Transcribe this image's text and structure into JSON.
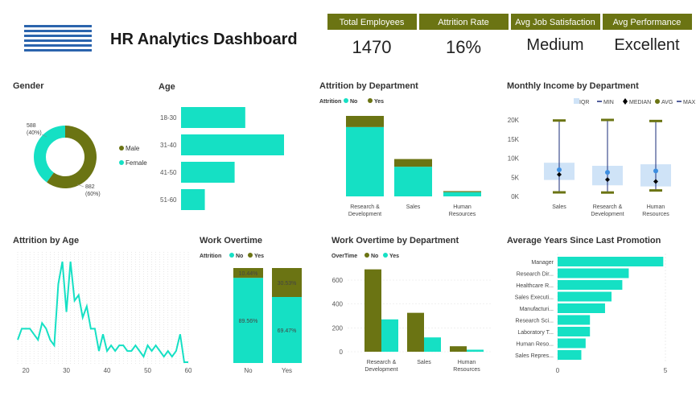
{
  "header": {
    "logo": "IBM",
    "title": "HR Analytics Dashboard"
  },
  "colors": {
    "primary": "#15e0c4",
    "secondary": "#6b7413",
    "iqr": "#cfe3f7",
    "median": "#000000",
    "avg": "#3d8ee0",
    "whisker": "#1a2b7a"
  },
  "kpis": [
    {
      "label": "Total Employees",
      "value": "1470"
    },
    {
      "label": "Attrition Rate",
      "value": "16%"
    },
    {
      "label": "Avg Job Satisfaction",
      "value": "Medium"
    },
    {
      "label": "Avg Performance",
      "value": "Excellent"
    }
  ],
  "chart_data": [
    {
      "id": "gender",
      "type": "pie",
      "title": "Gender",
      "legend": [
        "Male",
        "Female"
      ],
      "labels": [
        "588\n(40%)",
        "882\n(60%)"
      ],
      "values": [
        882,
        588
      ]
    },
    {
      "id": "age",
      "type": "bar",
      "title": "Age",
      "categories": [
        "18-30",
        "31-40",
        "41-50",
        "51-60"
      ],
      "values": [
        386,
        619,
        322,
        143
      ],
      "xlim": [
        0,
        619
      ]
    },
    {
      "id": "attr_dept",
      "type": "bar",
      "title": "Attrition by Department",
      "legend_title": "Attrition",
      "categories": [
        "Research &\nDevelopment",
        "Sales",
        "Human\nResources"
      ],
      "series": [
        {
          "name": "No",
          "values": [
            828,
            354,
            51
          ]
        },
        {
          "name": "Yes",
          "values": [
            133,
            92,
            12
          ]
        }
      ],
      "ylim": [
        0,
        961
      ]
    },
    {
      "id": "income_dept",
      "type": "box",
      "title": "Monthly Income by Department",
      "legend": [
        "IQR",
        "MIN",
        "MEDIAN",
        "AVG",
        "MAX"
      ],
      "categories": [
        "Sales",
        "Research &\nDevelopment",
        "Human\nResources"
      ],
      "y_ticks": [
        "0K",
        "5K",
        "10K",
        "15K",
        "20K"
      ],
      "ylim": [
        0,
        20000
      ],
      "stats": [
        {
          "min": 1052,
          "q1": 4300,
          "median": 5700,
          "avg": 6960,
          "q3": 8800,
          "max": 19850
        },
        {
          "min": 1009,
          "q1": 2900,
          "median": 4400,
          "avg": 6280,
          "q3": 8000,
          "max": 19999
        },
        {
          "min": 1555,
          "q1": 2600,
          "median": 3900,
          "avg": 6650,
          "q3": 8400,
          "max": 19717
        }
      ]
    },
    {
      "id": "attr_age",
      "type": "line",
      "title": "Attrition by Age",
      "x": [
        18,
        19,
        20,
        21,
        22,
        23,
        24,
        25,
        26,
        27,
        28,
        29,
        30,
        31,
        32,
        33,
        34,
        35,
        36,
        37,
        38,
        39,
        40,
        41,
        42,
        43,
        44,
        45,
        46,
        47,
        48,
        49,
        50,
        51,
        52,
        53,
        54,
        55,
        56,
        57,
        58,
        59,
        60
      ],
      "values": [
        4,
        6,
        6,
        6,
        5,
        4,
        7,
        6,
        4,
        3,
        14,
        18,
        9,
        18,
        11,
        12,
        8,
        10,
        6,
        6,
        2,
        5,
        2,
        3,
        2,
        3,
        3,
        2,
        2,
        3,
        2,
        1,
        3,
        2,
        3,
        2,
        1,
        2,
        1,
        2,
        5,
        0,
        0
      ],
      "x_ticks": [
        20,
        30,
        40,
        50,
        60
      ],
      "xlim": [
        18,
        60
      ],
      "ylim": [
        0,
        18
      ]
    },
    {
      "id": "overtime",
      "type": "bar",
      "title": "Work Overtime",
      "legend_title": "Attrition",
      "categories": [
        "No",
        "Yes"
      ],
      "series": [
        {
          "name": "No",
          "values": [
            89.56,
            69.47
          ],
          "labels": [
            "89.56%",
            "69.47%"
          ]
        },
        {
          "name": "Yes",
          "values": [
            10.44,
            30.53
          ],
          "labels": [
            "10.44%",
            "30.53%"
          ]
        }
      ],
      "ylim": [
        0,
        100
      ]
    },
    {
      "id": "overtime_dept",
      "type": "bar",
      "title": "Work Overtime by Department",
      "legend_title": "OverTime",
      "categories": [
        "Research &\nDevelopment",
        "Sales",
        "Human\nResources"
      ],
      "series": [
        {
          "name": "No",
          "values": [
            690,
            326,
            46
          ]
        },
        {
          "name": "Yes",
          "values": [
            271,
            120,
            17
          ]
        }
      ],
      "y_ticks": [
        0,
        200,
        400,
        600
      ],
      "ylim": [
        0,
        700
      ]
    },
    {
      "id": "promotion",
      "type": "bar",
      "title": "Average Years Since Last Promotion",
      "categories": [
        "Manager",
        "Research Dir...",
        "Healthcare R...",
        "Sales Executi...",
        "Manufacturi...",
        "Research Sci...",
        "Laboratory T...",
        "Human Reso...",
        "Sales Repres..."
      ],
      "values": [
        4.9,
        3.3,
        3.0,
        2.5,
        2.2,
        1.5,
        1.5,
        1.3,
        1.1
      ],
      "x_ticks": [
        0,
        5
      ],
      "xlim": [
        0,
        5
      ]
    }
  ]
}
